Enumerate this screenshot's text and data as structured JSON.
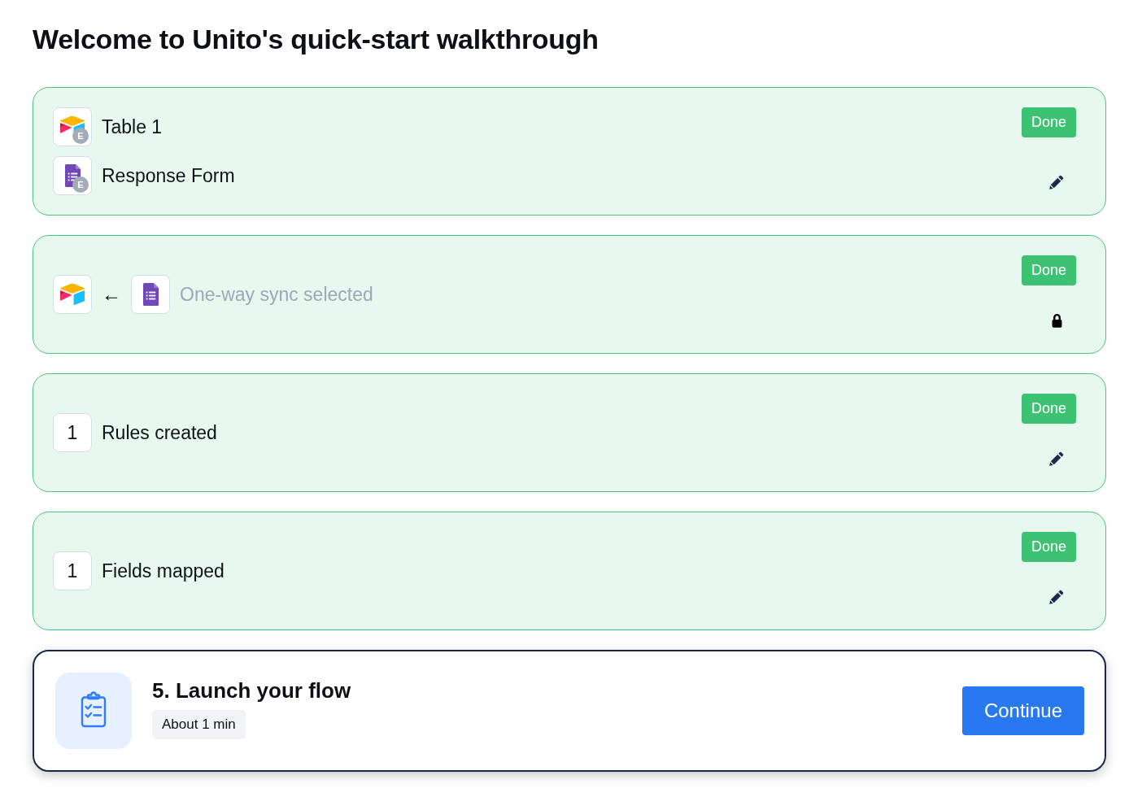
{
  "title": "Welcome to Unito's quick-start walkthrough",
  "steps": [
    {
      "kind": "connections",
      "completed": true,
      "status": "Done",
      "locked": false,
      "apps": [
        {
          "kind": "table",
          "label": "Table 1",
          "initial": "E"
        },
        {
          "kind": "form",
          "label": "Response Form",
          "initial": "E"
        }
      ]
    },
    {
      "kind": "sync",
      "completed": true,
      "status": "Done",
      "locked": true,
      "apps": [
        {
          "kind": "table"
        },
        {
          "kind": "form"
        }
      ],
      "arrow": "←",
      "label": "One-way sync selected"
    },
    {
      "kind": "count",
      "completed": true,
      "status": "Done",
      "locked": false,
      "count": "1",
      "label": "Rules created"
    },
    {
      "kind": "count",
      "completed": true,
      "status": "Done",
      "locked": false,
      "count": "1",
      "label": "Fields mapped"
    }
  ],
  "current_step": {
    "title": "5. Launch your flow",
    "duration": "About 1 min",
    "button": "Continue"
  }
}
